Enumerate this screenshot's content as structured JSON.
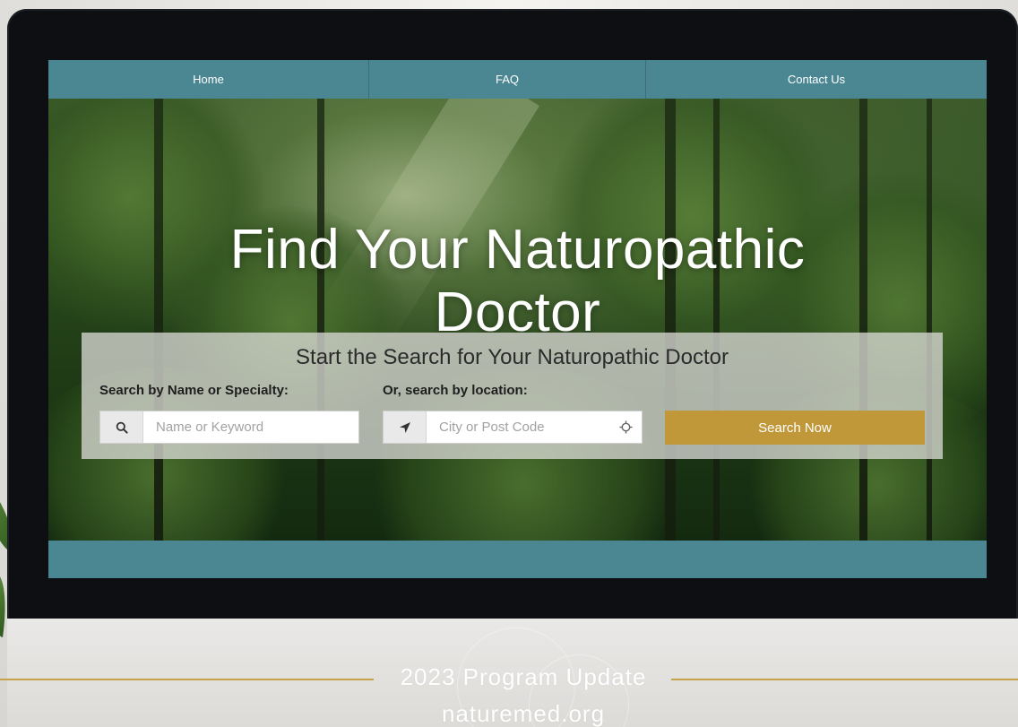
{
  "nav": {
    "items": [
      {
        "label": "Home"
      },
      {
        "label": "FAQ"
      },
      {
        "label": "Contact Us"
      }
    ]
  },
  "hero": {
    "title_line1": "Find Your Naturopathic",
    "title_line2": "Doctor"
  },
  "search": {
    "panel_title": "Start the Search for Your Naturopathic Doctor",
    "name_label": "Search by Name or Specialty:",
    "name_placeholder": "Name or Keyword",
    "name_icon": "search-icon",
    "location_label": "Or, search by location:",
    "location_placeholder": "City or Post Code",
    "location_icon": "location-arrow-icon",
    "locate_icon": "crosshair-icon",
    "button_label": "Search Now"
  },
  "caption": {
    "line1": "2023 Program Update",
    "line2": "naturemed.org"
  },
  "colors": {
    "teal": "#4b8793",
    "gold": "#c0983a"
  }
}
